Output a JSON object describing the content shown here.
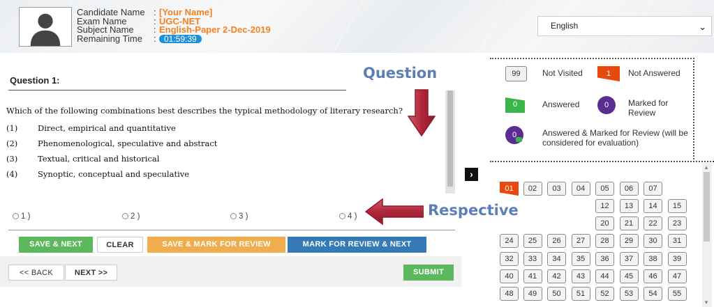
{
  "header": {
    "candidate_label": "Candidate Name",
    "candidate_value": "[Your Name]",
    "exam_label": "Exam Name",
    "exam_value": "UGC-NET",
    "subject_label": "Subject Name",
    "subject_value": "English-Paper 2-Dec-2019",
    "time_label": "Remaining Time",
    "time_value": "01:59:39",
    "language": "English"
  },
  "question": {
    "title": "Question 1:",
    "text": "Which of the following combinations best describes the typical methodology of literary research?",
    "options": [
      {
        "num": "(1)",
        "text": "Direct, empirical and quantitative"
      },
      {
        "num": "(2)",
        "text": "Phenomenological, speculative and abstract"
      },
      {
        "num": "(3)",
        "text": "Textual, critical and historical"
      },
      {
        "num": "(4)",
        "text": "Synoptic, conceptual and speculative"
      }
    ],
    "radio_labels": [
      "1 )",
      "2 )",
      "3 )",
      "4 )"
    ]
  },
  "actions": {
    "save_next": "SAVE & NEXT",
    "clear": "CLEAR",
    "save_mark": "SAVE & MARK FOR REVIEW",
    "mark_next": "MARK FOR REVIEW & NEXT",
    "back": "<< BACK",
    "next": "NEXT >>",
    "submit": "SUBMIT"
  },
  "annotations": {
    "question": "Question",
    "respective": "Respective"
  },
  "legend": {
    "not_visited_count": "99",
    "not_visited_label": "Not Visited",
    "not_answered_count": "1",
    "not_answered_label": "Not Answered",
    "answered_count": "0",
    "answered_label": "Answered",
    "marked_count": "0",
    "marked_label": "Marked for Review",
    "answered_marked_count": "0",
    "answered_marked_label": "Answered & Marked for Review (will be considered for evaluation)"
  },
  "palette": {
    "row1": [
      "01",
      "02",
      "03",
      "04",
      "05",
      "06",
      "07"
    ],
    "row2": [
      "12",
      "13",
      "14",
      "15"
    ],
    "row3": [
      "20",
      "21",
      "22",
      "23"
    ],
    "row4": [
      "24",
      "25",
      "26",
      "27",
      "28",
      "29",
      "30",
      "31"
    ],
    "row5": [
      "32",
      "33",
      "34",
      "35",
      "36",
      "37",
      "38",
      "39"
    ],
    "row6": [
      "40",
      "41",
      "42",
      "43",
      "44",
      "45",
      "46",
      "47"
    ],
    "row7": [
      "48",
      "49",
      "50",
      "51",
      "52",
      "53",
      "54",
      "55"
    ]
  },
  "colors": {
    "not_answered": "#e8490f",
    "answered": "#39b54a",
    "marked": "#5c2d91",
    "annotation_arrow": "#b0263a",
    "annotation_text": "#5b7fb6"
  }
}
